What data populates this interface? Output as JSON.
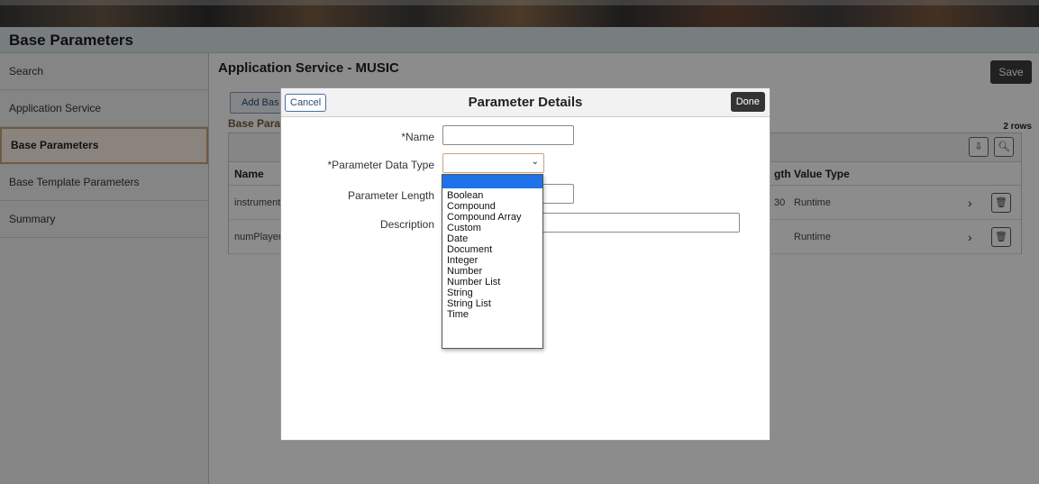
{
  "page": {
    "title": "Base Parameters"
  },
  "nav": {
    "items": [
      {
        "label": "Search"
      },
      {
        "label": "Application Service"
      },
      {
        "label": "Base Parameters"
      },
      {
        "label": "Base Template Parameters"
      },
      {
        "label": "Summary"
      }
    ]
  },
  "main": {
    "title": "Application Service - MUSIC",
    "save_label": "Save",
    "add_label": "Add Bas",
    "grid_title": "Base Para",
    "rows_count": "2 rows",
    "columns": {
      "name": "Name",
      "length": "gth",
      "value_type": "Value Type"
    },
    "rows": [
      {
        "name": "instrument",
        "length": "30",
        "value_type": "Runtime"
      },
      {
        "name": "numPlayer",
        "length": "",
        "value_type": "Runtime"
      }
    ]
  },
  "modal": {
    "title": "Parameter Details",
    "cancel_label": "Cancel",
    "done_label": "Done",
    "fields": {
      "name_label": "*Name",
      "name_value": "",
      "type_label": "*Parameter Data Type",
      "type_value": "",
      "length_label": "Parameter Length",
      "length_value": "",
      "description_label": "Description",
      "description_value": ""
    },
    "type_options": [
      "",
      "Boolean",
      "Compound",
      "Compound Array",
      "Custom",
      "Date",
      "Document",
      "Integer",
      "Number",
      "Number List",
      "String",
      "String List",
      "Time"
    ]
  }
}
